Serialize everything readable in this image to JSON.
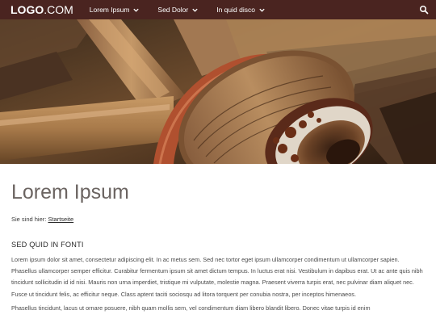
{
  "header": {
    "logo_strong": "LOGO",
    "logo_light": ".COM",
    "nav": [
      {
        "label": "Lorem Ipsum"
      },
      {
        "label": "Sed Dolor"
      },
      {
        "label": "In quid disco"
      }
    ],
    "colors": {
      "bar": "#4a2420",
      "text": "#ffffff"
    },
    "icons": {
      "search": "search-icon",
      "dropdown": "chevron-down-icon"
    }
  },
  "hero": {
    "image": "wooden-wagon-wheel-photo"
  },
  "main": {
    "title": "Lorem Ipsum",
    "breadcrumb_prefix": "Sie sind hier:",
    "breadcrumb_link": "Startseite",
    "section_title": "SED QUID IN FONTI",
    "paragraphs": [
      "Lorem ipsum dolor sit amet, consectetur adipiscing elit. In ac metus sem. Sed nec tortor eget ipsum ullamcorper condimentum ut ullamcorper sapien. Phasellus ullamcorper semper efficitur. Curabitur fermentum ipsum sit amet dictum tempus. In luctus erat nisi. Vestibulum in dapibus erat. Ut ac ante quis nibh tincidunt sollicitudin id id nisi. Mauris non urna imperdiet, tristique mi vulputate, molestie magna. Praesent viverra turpis erat, nec pulvinar diam aliquet nec. Fusce ut tincidunt felis, ac efficitur neque. Class aptent taciti sociosqu ad litora torquent per conubia nostra, per inceptos himenaeos.",
      "Phasellus tincidunt, lacus ut ornare posuere, nibh quam mollis sem, vel condimentum diam libero blandit libero. Donec vitae turpis id enim"
    ]
  }
}
